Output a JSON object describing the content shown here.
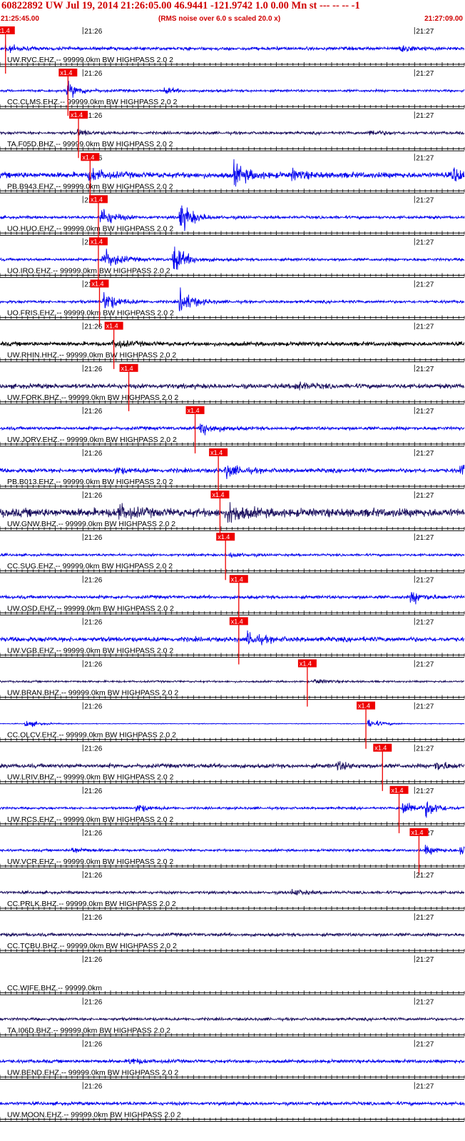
{
  "header": {
    "title": "60822892 UW Jul 19, 2014 21:26:05.00   46.9441 -121.9742  1.0 0.00 Mn st --- -- --   -1",
    "start_time": "21:25:45.00",
    "end_time": "21:27:09.00",
    "rms_note": "(RMS noise over 6.0 s scaled 20.0 x)"
  },
  "colors": {
    "title": "#d00000",
    "axis": "#000000",
    "trace_blue": "#0000ee",
    "trace_black": "#000000",
    "trace_navy": "#1a0f5e",
    "pick_marker": "#ee0000"
  },
  "chart_data": {
    "type": "line",
    "description_type": "seismogram record section",
    "time_range": [
      "21:25:45.00",
      "21:27:09.00"
    ],
    "minute_ticks": [
      {
        "label": "21:26",
        "seconds": 15
      },
      {
        "label": "21:27",
        "seconds": 75
      }
    ],
    "pick_label": "x1.4",
    "traces": [
      {
        "label": "UW.RVC.EHZ.-- 99999.0km BW  HIGHPASS  2.0  2",
        "color": "blue",
        "pick_seconds": 1.0,
        "amplitude": 0.35,
        "events": [
          {
            "t": 1.2,
            "a": 0.7
          },
          {
            "t": 72.5,
            "a": 0.8
          }
        ]
      },
      {
        "label": "CC.CLMS.EHZ.-- 99999.0km BW  HIGHPASS  2.0  2",
        "color": "blue",
        "pick_seconds": 12.3,
        "amplitude": 0.25,
        "events": [
          {
            "t": 12.3,
            "a": 1.6
          },
          {
            "t": 30.0,
            "a": 0.5
          }
        ]
      },
      {
        "label": "TA.F05D.BHZ.-- 99999.0km BW  HIGHPASS  2.0  2",
        "color": "navy",
        "pick_seconds": 14.2,
        "amplitude": 0.3,
        "events": [
          {
            "t": 14.2,
            "a": 0.6
          },
          {
            "t": 67.0,
            "a": 0.6
          }
        ]
      },
      {
        "label": "PB.B943.EHZ.-- 99999.0km BW  HIGHPASS  2.0  2",
        "color": "blue",
        "pick_seconds": 16.3,
        "amplitude": 0.6,
        "events": [
          {
            "t": 16.3,
            "a": 1.4
          },
          {
            "t": 42.5,
            "a": 2.2
          },
          {
            "t": 53.0,
            "a": 0.9
          },
          {
            "t": 82.0,
            "a": 1.6
          }
        ]
      },
      {
        "label": "UO.HUO.EHZ.-- 99999.0km BW  HIGHPASS  2.0  2",
        "color": "blue",
        "pick_seconds": 17.8,
        "amplitude": 0.3,
        "events": [
          {
            "t": 18.4,
            "a": 2.0
          },
          {
            "t": 32.7,
            "a": 3.0
          }
        ]
      },
      {
        "label": "UO.IRO.EHZ.-- 99999.0km BW  HIGHPASS  2.0  2",
        "color": "blue",
        "pick_seconds": 17.8,
        "amplitude": 0.3,
        "events": [
          {
            "t": 18.7,
            "a": 2.5
          },
          {
            "t": 31.5,
            "a": 2.8
          }
        ]
      },
      {
        "label": "UO.FRIS.EHZ.-- 99999.0km BW  HIGHPASS  2.0  2",
        "color": "blue",
        "pick_seconds": 18.0,
        "amplitude": 0.3,
        "events": [
          {
            "t": 18.9,
            "a": 2.0
          },
          {
            "t": 32.7,
            "a": 2.5
          }
        ]
      },
      {
        "label": "UW.RHIN.HHZ.-- 99999.0km BW  HIGHPASS  2.0  2",
        "color": "black",
        "pick_seconds": 20.6,
        "amplitude": 0.45,
        "events": [
          {
            "t": 20.6,
            "a": 0.8
          }
        ]
      },
      {
        "label": "UW.FORK.BHZ.-- 99999.0km BW  HIGHPASS  2.0  2",
        "color": "navy",
        "pick_seconds": 23.3,
        "amplitude": 0.5,
        "events": [
          {
            "t": 53.6,
            "a": 0.8
          }
        ]
      },
      {
        "label": "UW.JORV.EHZ.-- 99999.0km BW  HIGHPASS  2.0  2",
        "color": "blue",
        "pick_seconds": 35.3,
        "amplitude": 0.35,
        "events": [
          {
            "t": 36.5,
            "a": 1.6
          }
        ]
      },
      {
        "label": "PB.B013.EHZ.-- 99999.0km BW  HIGHPASS  2.0  2",
        "color": "blue",
        "pick_seconds": 39.5,
        "amplitude": 0.45,
        "events": [
          {
            "t": 41.0,
            "a": 1.4
          },
          {
            "t": 21.0,
            "a": 0.6
          },
          {
            "t": 83.5,
            "a": 1.2
          }
        ]
      },
      {
        "label": "UW.GNW.BHZ.-- 99999.0km BW  HIGHPASS  2.0  2",
        "color": "navy",
        "pick_seconds": 39.8,
        "amplitude": 0.9,
        "events": [
          {
            "t": 21.5,
            "a": 1.4
          },
          {
            "t": 41.5,
            "a": 2.0
          }
        ]
      },
      {
        "label": "CC.SUG.EHZ.-- 99999.0km BW  HIGHPASS  2.0  2",
        "color": "blue",
        "pick_seconds": 40.8,
        "amplitude": 0.25,
        "events": [
          {
            "t": 41.8,
            "a": 0.5
          }
        ]
      },
      {
        "label": "UW.OSD.EHZ.-- 99999.0km BW  HIGHPASS  2.0  2",
        "color": "blue",
        "pick_seconds": 43.2,
        "amplitude": 0.35,
        "events": [
          {
            "t": 74.5,
            "a": 1.2
          }
        ]
      },
      {
        "label": "UW.VGB.EHZ.-- 99999.0km BW  HIGHPASS  2.0  2",
        "color": "blue",
        "pick_seconds": 43.2,
        "amplitude": 0.5,
        "events": [
          {
            "t": 45.0,
            "a": 1.3
          }
        ]
      },
      {
        "label": "UW.BRAN.BHZ.-- 99999.0km BW  HIGHPASS  2.0  2",
        "color": "navy",
        "pick_seconds": 55.6,
        "amplitude": 0.2,
        "events": [
          {
            "t": 57.0,
            "a": 0.5
          }
        ]
      },
      {
        "label": "CC.OLCV.EHZ.-- 99999.0km BW  HIGHPASS  2.0  2",
        "color": "blue",
        "pick_seconds": 66.2,
        "amplitude": 0.08,
        "events": [
          {
            "t": 4.7,
            "a": 0.8
          },
          {
            "t": 66.8,
            "a": 1.0
          }
        ]
      },
      {
        "label": "UW.LRIV.BHZ.-- 99999.0km BW  HIGHPASS  2.0  2",
        "color": "navy",
        "pick_seconds": 69.2,
        "amplitude": 0.45,
        "events": [
          {
            "t": 61.0,
            "a": 0.8
          },
          {
            "t": 79.0,
            "a": 0.9
          }
        ]
      },
      {
        "label": "UW.RCS.EHZ.-- 99999.0km BW  HIGHPASS  2.0  2",
        "color": "blue",
        "pick_seconds": 72.2,
        "amplitude": 0.25,
        "events": [
          {
            "t": 24.9,
            "a": 0.8
          },
          {
            "t": 73.0,
            "a": 1.6
          },
          {
            "t": 77.3,
            "a": 1.4
          }
        ]
      },
      {
        "label": "UW.VCR.EHZ.-- 99999.0km BW  HIGHPASS  2.0  2",
        "color": "blue",
        "pick_seconds": 75.8,
        "amplitude": 0.25,
        "events": [
          {
            "t": 13.2,
            "a": 0.6
          },
          {
            "t": 77.0,
            "a": 0.9
          },
          {
            "t": 83.5,
            "a": 1.2
          }
        ]
      },
      {
        "label": "CC.PRLK.BHZ.-- 99999.0km BW  HIGHPASS  2.0  2",
        "color": "navy",
        "pick_seconds": null,
        "amplitude": 0.3,
        "events": [
          {
            "t": 53.0,
            "a": 0.6
          }
        ]
      },
      {
        "label": "CC.TCBU.BHZ.-- 99999.0km BW  HIGHPASS  2.0  2",
        "color": "navy",
        "pick_seconds": null,
        "amplitude": 0.35,
        "events": []
      },
      {
        "label": "CC.WIFE.BHZ.-- 99999.0km",
        "color": "navy",
        "pick_seconds": null,
        "amplitude": 0.0,
        "events": []
      },
      {
        "label": "TA.I06D.BHZ.-- 99999.0km BW  HIGHPASS  2.0  2",
        "color": "navy",
        "pick_seconds": null,
        "amplitude": 0.3,
        "events": []
      },
      {
        "label": "UW.BEND.EHZ.-- 99999.0km BW  HIGHPASS  2.0  2",
        "color": "blue",
        "pick_seconds": null,
        "amplitude": 0.35,
        "events": [
          {
            "t": 23.5,
            "a": 0.6
          }
        ]
      },
      {
        "label": "UW.MOON.EHZ.-- 99999.0km BW  HIGHPASS  2.0  2",
        "color": "blue",
        "pick_seconds": null,
        "amplitude": 0.35,
        "events": []
      }
    ]
  }
}
